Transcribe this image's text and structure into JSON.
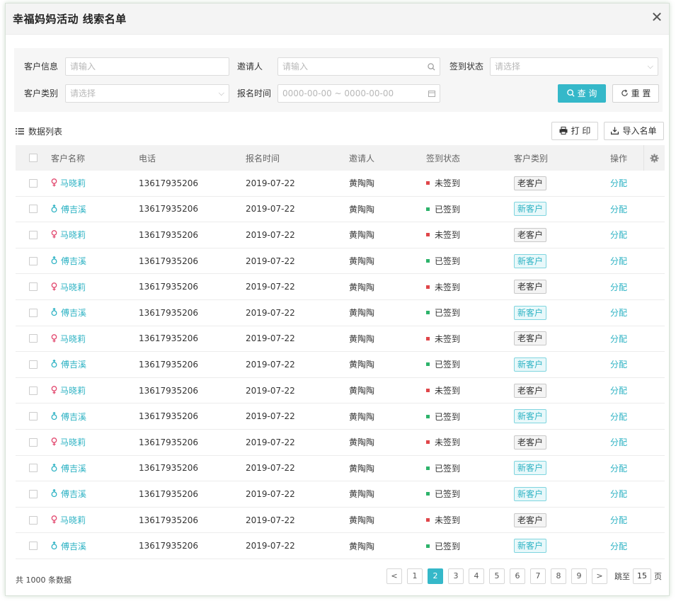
{
  "dialog": {
    "title": "幸福妈妈活动 线索名单",
    "close_glyph": "✕"
  },
  "filters": {
    "customer_info": {
      "label": "客户信息",
      "placeholder": "请输入"
    },
    "inviter": {
      "label": "邀请人",
      "placeholder": "请输入"
    },
    "checkin_status": {
      "label": "签到状态",
      "placeholder": "请选择"
    },
    "customer_type": {
      "label": "客户类别",
      "placeholder": "请选择"
    },
    "signup_time": {
      "label": "报名时间",
      "placeholder": "0000-00-00 ~ 0000-00-00"
    },
    "query_label": "查 询",
    "reset_label": "重 置"
  },
  "toolbar": {
    "list_title": "数据列表",
    "print_label": "打 印",
    "export_label": "导入名单"
  },
  "table": {
    "columns": [
      "客户名称",
      "电话",
      "报名时间",
      "邀请人",
      "签到状态",
      "客户类别",
      "操作"
    ],
    "rows": [
      {
        "name": "马晓莉",
        "gender": "female",
        "phone": "13617935206",
        "date": "2019-07-22",
        "inviter": "黄陶陶",
        "status": "未签到",
        "type": "老客户",
        "op": "分配"
      },
      {
        "name": "傅吉溪",
        "gender": "male",
        "phone": "13617935206",
        "date": "2019-07-22",
        "inviter": "黄陶陶",
        "status": "已签到",
        "type": "新客户",
        "op": "分配"
      },
      {
        "name": "马晓莉",
        "gender": "female",
        "phone": "13617935206",
        "date": "2019-07-22",
        "inviter": "黄陶陶",
        "status": "未签到",
        "type": "老客户",
        "op": "分配"
      },
      {
        "name": "傅吉溪",
        "gender": "male",
        "phone": "13617935206",
        "date": "2019-07-22",
        "inviter": "黄陶陶",
        "status": "已签到",
        "type": "新客户",
        "op": "分配"
      },
      {
        "name": "马晓莉",
        "gender": "female",
        "phone": "13617935206",
        "date": "2019-07-22",
        "inviter": "黄陶陶",
        "status": "未签到",
        "type": "老客户",
        "op": "分配"
      },
      {
        "name": "傅吉溪",
        "gender": "male",
        "phone": "13617935206",
        "date": "2019-07-22",
        "inviter": "黄陶陶",
        "status": "已签到",
        "type": "新客户",
        "op": "分配"
      },
      {
        "name": "马晓莉",
        "gender": "female",
        "phone": "13617935206",
        "date": "2019-07-22",
        "inviter": "黄陶陶",
        "status": "未签到",
        "type": "老客户",
        "op": "分配"
      },
      {
        "name": "傅吉溪",
        "gender": "male",
        "phone": "13617935206",
        "date": "2019-07-22",
        "inviter": "黄陶陶",
        "status": "已签到",
        "type": "新客户",
        "op": "分配"
      },
      {
        "name": "马晓莉",
        "gender": "female",
        "phone": "13617935206",
        "date": "2019-07-22",
        "inviter": "黄陶陶",
        "status": "未签到",
        "type": "老客户",
        "op": "分配"
      },
      {
        "name": "傅吉溪",
        "gender": "male",
        "phone": "13617935206",
        "date": "2019-07-22",
        "inviter": "黄陶陶",
        "status": "已签到",
        "type": "新客户",
        "op": "分配"
      },
      {
        "name": "马晓莉",
        "gender": "female",
        "phone": "13617935206",
        "date": "2019-07-22",
        "inviter": "黄陶陶",
        "status": "未签到",
        "type": "老客户",
        "op": "分配"
      },
      {
        "name": "傅吉溪",
        "gender": "male",
        "phone": "13617935206",
        "date": "2019-07-22",
        "inviter": "黄陶陶",
        "status": "已签到",
        "type": "新客户",
        "op": "分配"
      },
      {
        "name": "傅吉溪",
        "gender": "male",
        "phone": "13617935206",
        "date": "2019-07-22",
        "inviter": "黄陶陶",
        "status": "已签到",
        "type": "新客户",
        "op": "分配"
      },
      {
        "name": "马晓莉",
        "gender": "female",
        "phone": "13617935206",
        "date": "2019-07-22",
        "inviter": "黄陶陶",
        "status": "未签到",
        "type": "老客户",
        "op": "分配"
      },
      {
        "name": "傅吉溪",
        "gender": "male",
        "phone": "13617935206",
        "date": "2019-07-22",
        "inviter": "黄陶陶",
        "status": "已签到",
        "type": "新客户",
        "op": "分配"
      }
    ]
  },
  "pagination": {
    "total_text": "共 1000 条数据",
    "prev": "<",
    "next": ">",
    "pages": [
      "1",
      "2",
      "3",
      "4",
      "5",
      "6",
      "7",
      "8",
      "9"
    ],
    "current": "2",
    "jump_label": "跳至",
    "jump_value": "15",
    "jump_suffix": "页"
  },
  "colors": {
    "accent": "#35b8c9",
    "signed_dot": "#2db36b",
    "unsigned_dot": "#e0464a",
    "female": "#e24a70"
  }
}
